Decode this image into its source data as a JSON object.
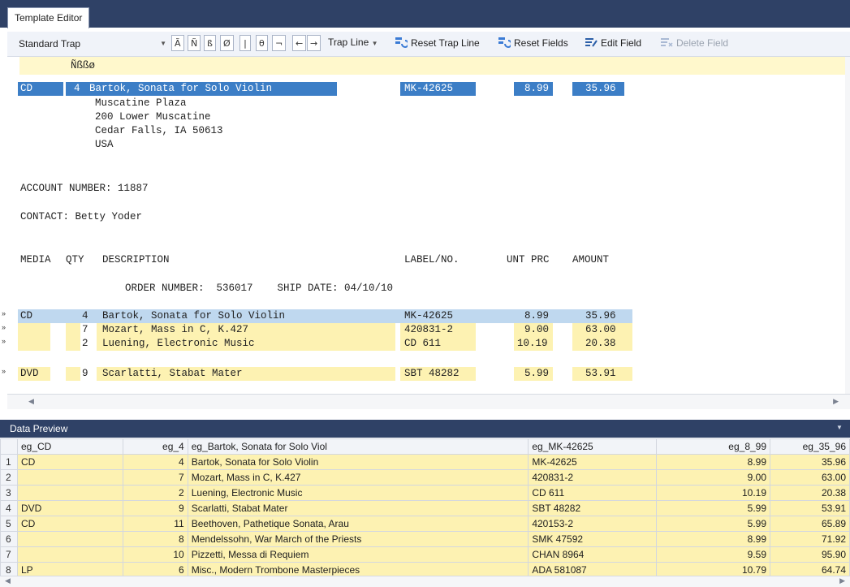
{
  "tab_title": "Template Editor",
  "toolbar": {
    "trap_select": "Standard Trap",
    "char_buttons": [
      "Ã",
      "Ñ",
      "ß",
      "Ø",
      "|",
      "θ",
      "¬"
    ],
    "prev_arrow": "←",
    "next_arrow": "→",
    "trap_line": "Trap Line",
    "reset_trap_line": "Reset Trap Line",
    "reset_fields": "Reset Fields",
    "edit_field": "Edit Field",
    "delete_field": "Delete Field"
  },
  "editor": {
    "special_chars": "Ñßßø",
    "first_line": {
      "media": "CD",
      "qty": "4",
      "desc": "Bartok, Sonata for Solo Violin",
      "label": "MK-42625",
      "unit": "8.99",
      "amount": "35.96"
    },
    "address": [
      "Muscatine Plaza",
      "200 Lower Muscatine",
      "Cedar Falls, IA 50613",
      "USA"
    ],
    "account": "ACCOUNT NUMBER: 11887",
    "contact": "CONTACT: Betty Yoder",
    "col_media": "MEDIA",
    "col_qty": "QTY",
    "col_desc": "DESCRIPTION",
    "col_label": "LABEL/NO.",
    "col_unit": "UNT PRC",
    "col_amount": "AMOUNT",
    "order_line": "ORDER NUMBER:  536017    SHIP DATE: 04/10/10",
    "rows": [
      {
        "media": "CD",
        "qty": "4",
        "desc": "Bartok, Sonata for Solo Violin",
        "label": "MK-42625",
        "unit": "8.99",
        "amount": "35.96"
      },
      {
        "media": "",
        "qty": "7",
        "desc": "Mozart, Mass in C, K.427",
        "label": "420831-2",
        "unit": "9.00",
        "amount": "63.00"
      },
      {
        "media": "",
        "qty": "2",
        "desc": "Luening, Electronic Music",
        "label": "CD 611",
        "unit": "10.19",
        "amount": "20.38"
      },
      {
        "media": "DVD",
        "qty": "9",
        "desc": "Scarlatti, Stabat Mater",
        "label": "SBT 48282",
        "unit": "5.99",
        "amount": "53.91"
      }
    ]
  },
  "data_preview": {
    "title": "Data Preview",
    "headers": [
      "eg_CD",
      "eg_4",
      "eg_Bartok, Sonata for Solo Viol",
      "eg_MK-42625",
      "eg_8_99",
      "eg_35_96"
    ],
    "rows": [
      [
        "1",
        "CD",
        "4",
        "Bartok, Sonata for Solo Violin",
        "MK-42625",
        "8.99",
        "35.96"
      ],
      [
        "2",
        "",
        "7",
        "Mozart, Mass in C, K.427",
        "420831-2",
        "9.00",
        "63.00"
      ],
      [
        "3",
        "",
        "2",
        "Luening, Electronic Music",
        "CD 611",
        "10.19",
        "20.38"
      ],
      [
        "4",
        "DVD",
        "9",
        "Scarlatti, Stabat Mater",
        "SBT 48282",
        "5.99",
        "53.91"
      ],
      [
        "5",
        "CD",
        "11",
        "Beethoven, Pathetique Sonata, Arau",
        "420153-2",
        "5.99",
        "65.89"
      ],
      [
        "6",
        "",
        "8",
        "Mendelssohn, War March of the Priests",
        "SMK 47592",
        "8.99",
        "71.92"
      ],
      [
        "7",
        "",
        "10",
        "Pizzetti, Messa di Requiem",
        "CHAN 8964",
        "9.59",
        "95.90"
      ],
      [
        "8",
        "LP",
        "6",
        "Misc., Modern Trombone Masterpieces",
        "ADA 581087",
        "10.79",
        "64.74"
      ]
    ]
  },
  "colors": {
    "accent": "#2f4166",
    "selection": "#3c7ec6",
    "highlight": "#fdf2b2"
  }
}
